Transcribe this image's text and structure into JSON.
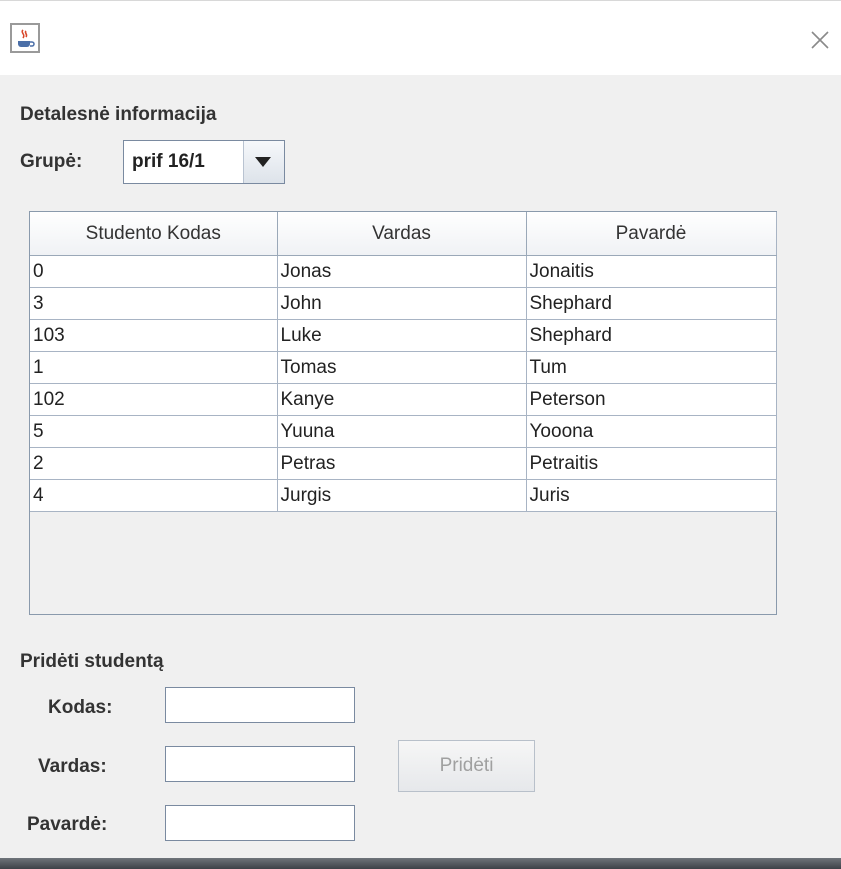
{
  "window": {
    "icon": "java-cup-icon",
    "close_icon": "close-icon"
  },
  "details": {
    "heading": "Detalesnė informacija",
    "group_label": "Grupė:",
    "group_value": "prif 16/1"
  },
  "table": {
    "columns": [
      "Studento Kodas",
      "Vardas",
      "Pavardė"
    ],
    "rows": [
      [
        "0",
        "Jonas",
        "Jonaitis"
      ],
      [
        "3",
        "John",
        "Shephard"
      ],
      [
        "103",
        "Luke",
        "Shephard"
      ],
      [
        "1",
        "Tomas",
        "Tum"
      ],
      [
        "102",
        "Kanye",
        "Peterson"
      ],
      [
        "5",
        "Yuuna",
        "Yooona"
      ],
      [
        "2",
        "Petras",
        "Petraitis"
      ],
      [
        "4",
        "Jurgis",
        "Juris"
      ]
    ]
  },
  "add_student": {
    "heading": "Pridėti studentą",
    "code_label": "Kodas:",
    "name_label": "Vardas:",
    "surname_label": "Pavardė:",
    "code_value": "",
    "name_value": "",
    "surname_value": "",
    "button_label": "Pridėti"
  }
}
